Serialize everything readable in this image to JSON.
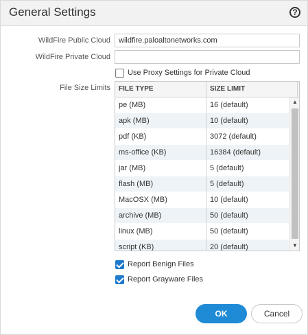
{
  "dialog": {
    "title": "General Settings",
    "help_icon": "question-circle-icon",
    "help_glyph": "?"
  },
  "form": {
    "public_cloud_label": "WildFire Public Cloud",
    "public_cloud_value": "wildfire.paloaltonetworks.com",
    "private_cloud_label": "WildFire Private Cloud",
    "private_cloud_value": "",
    "proxy_label": "Use Proxy Settings for Private Cloud",
    "proxy_checked": false,
    "file_size_label": "File Size Limits"
  },
  "grid": {
    "columns": [
      "FILE TYPE",
      "SIZE LIMIT"
    ],
    "rows": [
      {
        "type": "pe (MB)",
        "limit": "16 (default)"
      },
      {
        "type": "apk (MB)",
        "limit": "10 (default)"
      },
      {
        "type": "pdf (KB)",
        "limit": "3072 (default)"
      },
      {
        "type": "ms-office (KB)",
        "limit": "16384 (default)"
      },
      {
        "type": "jar (MB)",
        "limit": "5 (default)"
      },
      {
        "type": "flash (MB)",
        "limit": "5 (default)"
      },
      {
        "type": "MacOSX (MB)",
        "limit": "10 (default)"
      },
      {
        "type": "archive (MB)",
        "limit": "50 (default)"
      },
      {
        "type": "linux (MB)",
        "limit": "50 (default)"
      },
      {
        "type": "script (KB)",
        "limit": "20 (default)"
      }
    ],
    "scroll_up_glyph": "▲",
    "scroll_down_glyph": "▼"
  },
  "options": {
    "report_benign_label": "Report Benign Files",
    "report_benign_checked": true,
    "report_grayware_label": "Report Grayware Files",
    "report_grayware_checked": true
  },
  "buttons": {
    "ok_label": "OK",
    "cancel_label": "Cancel"
  },
  "colors": {
    "accent": "#1f8ad6",
    "checkbox_checked": "#1f7acb",
    "row_alt": "#edf3f7",
    "title_bar": "#f2f2f2"
  }
}
